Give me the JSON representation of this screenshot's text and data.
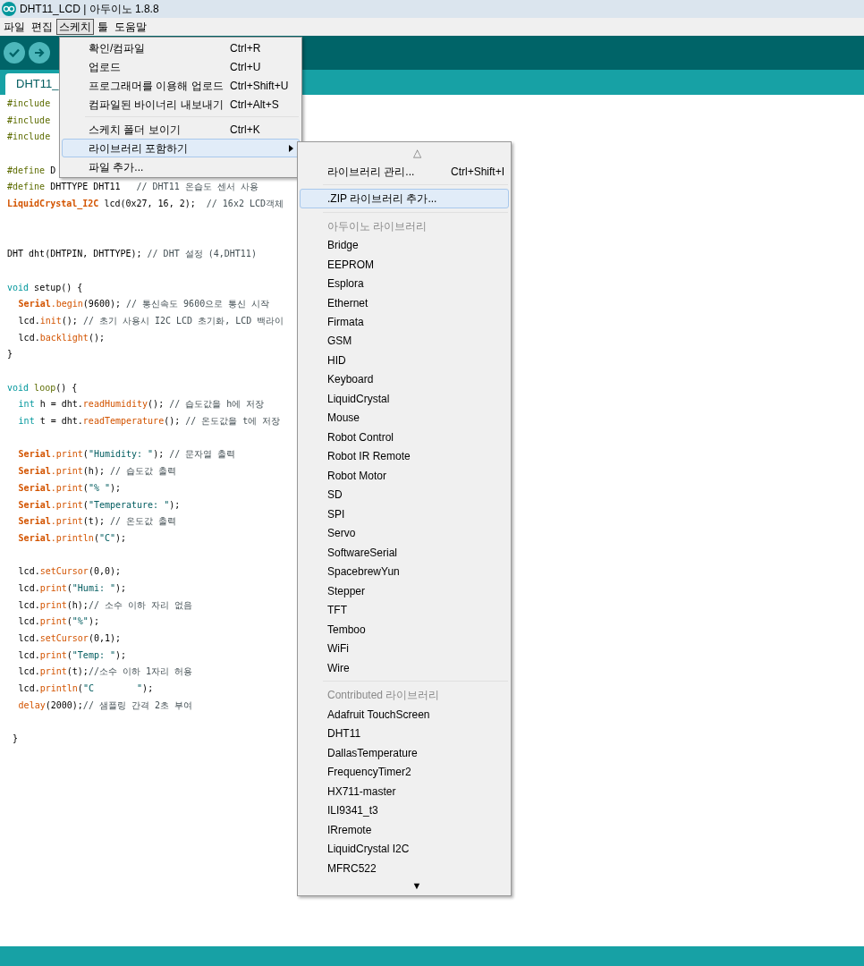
{
  "window": {
    "title": "DHT11_LCD | 아두이노 1.8.8"
  },
  "menu_bar": [
    {
      "label": "파일",
      "selected": false
    },
    {
      "label": "편집",
      "selected": false
    },
    {
      "label": "스케치",
      "selected": true
    },
    {
      "label": "툴",
      "selected": false
    },
    {
      "label": "도움말",
      "selected": false
    }
  ],
  "tab": {
    "label": "DHT11_"
  },
  "code_lines": [
    {
      "kind": "code",
      "indented": false,
      "segments": [
        {
          "kind": "pp",
          "text": "#include"
        }
      ]
    },
    {
      "kind": "code",
      "indented": false,
      "segments": [
        {
          "kind": "pp",
          "text": "#include"
        }
      ]
    },
    {
      "kind": "code",
      "indented": false,
      "segments": [
        {
          "kind": "pp",
          "text": "#include"
        }
      ]
    },
    {
      "kind": "blank"
    },
    {
      "kind": "code",
      "indented": false,
      "segments": [
        {
          "kind": "pp",
          "text": "#define"
        },
        {
          "kind": "p",
          "text": " D"
        }
      ]
    },
    {
      "kind": "code",
      "indented": false,
      "segments": [
        {
          "kind": "pp",
          "text": "#define"
        },
        {
          "kind": "p",
          "text": " DHTTYPE DHT11   "
        },
        {
          "kind": "cm",
          "text": "// DHT11 온습도 센서 사용"
        }
      ]
    },
    {
      "kind": "code",
      "indented": false,
      "segments": [
        {
          "kind": "cls",
          "text": "LiquidCrystal_I2C"
        },
        {
          "kind": "p",
          "text": " lcd(0x27, 16, 2);  "
        },
        {
          "kind": "cm",
          "text": "// 16x2 LCD객체"
        }
      ]
    },
    {
      "kind": "blank"
    },
    {
      "kind": "blank"
    },
    {
      "kind": "code",
      "indented": false,
      "segments": [
        {
          "kind": "p",
          "text": "DHT dht(DHTPIN, DHTTYPE); "
        },
        {
          "kind": "cm",
          "text": "// DHT 설정 (4,DHT11)"
        }
      ]
    },
    {
      "kind": "blank"
    },
    {
      "kind": "code",
      "indented": false,
      "segments": [
        {
          "kind": "kw",
          "text": "void"
        },
        {
          "kind": "p",
          "text": " setup() {"
        }
      ]
    },
    {
      "kind": "code",
      "indented": true,
      "segments": [
        {
          "kind": "cls",
          "text": "Serial"
        },
        {
          "kind": "fn",
          "text": ".begin"
        },
        {
          "kind": "p",
          "text": "(9600); "
        },
        {
          "kind": "cm",
          "text": "// 통신속도 9600으로 통신 시작"
        }
      ]
    },
    {
      "kind": "code",
      "indented": true,
      "segments": [
        {
          "kind": "p",
          "text": "lcd."
        },
        {
          "kind": "fn",
          "text": "init"
        },
        {
          "kind": "p",
          "text": "(); "
        },
        {
          "kind": "cm",
          "text": "// 초기 사용시 I2C LCD 초기화, LCD 백라이"
        }
      ]
    },
    {
      "kind": "code",
      "indented": true,
      "segments": [
        {
          "kind": "p",
          "text": "lcd."
        },
        {
          "kind": "fn",
          "text": "backlight"
        },
        {
          "kind": "p",
          "text": "();"
        }
      ]
    },
    {
      "kind": "code",
      "indented": false,
      "segments": [
        {
          "kind": "p",
          "text": "}"
        }
      ]
    },
    {
      "kind": "blank"
    },
    {
      "kind": "code",
      "indented": false,
      "segments": [
        {
          "kind": "kw",
          "text": "void"
        },
        {
          "kind": "kw2",
          "text": " loop"
        },
        {
          "kind": "p",
          "text": "() {"
        }
      ]
    },
    {
      "kind": "code",
      "indented": true,
      "segments": [
        {
          "kind": "kw",
          "text": "int"
        },
        {
          "kind": "p",
          "text": " h = dht."
        },
        {
          "kind": "fn",
          "text": "readHumidity"
        },
        {
          "kind": "p",
          "text": "(); "
        },
        {
          "kind": "cm",
          "text": "// 습도값을 h에 저장"
        }
      ]
    },
    {
      "kind": "code",
      "indented": true,
      "segments": [
        {
          "kind": "kw",
          "text": "int"
        },
        {
          "kind": "p",
          "text": " t = dht."
        },
        {
          "kind": "fn",
          "text": "readTemperature"
        },
        {
          "kind": "p",
          "text": "(); "
        },
        {
          "kind": "cm",
          "text": "// 온도값을 t에 저장"
        }
      ]
    },
    {
      "kind": "blank"
    },
    {
      "kind": "code",
      "indented": true,
      "segments": [
        {
          "kind": "cls",
          "text": "Serial"
        },
        {
          "kind": "fn",
          "text": ".print"
        },
        {
          "kind": "p",
          "text": "("
        },
        {
          "kind": "str",
          "text": "\"Humidity: \""
        },
        {
          "kind": "p",
          "text": "); "
        },
        {
          "kind": "cm",
          "text": "// 문자열 출력"
        }
      ]
    },
    {
      "kind": "code",
      "indented": true,
      "segments": [
        {
          "kind": "cls",
          "text": "Serial"
        },
        {
          "kind": "fn",
          "text": ".print"
        },
        {
          "kind": "p",
          "text": "(h); "
        },
        {
          "kind": "cm",
          "text": "// 습도값 출력"
        }
      ]
    },
    {
      "kind": "code",
      "indented": true,
      "segments": [
        {
          "kind": "cls",
          "text": "Serial"
        },
        {
          "kind": "fn",
          "text": ".print"
        },
        {
          "kind": "p",
          "text": "("
        },
        {
          "kind": "str",
          "text": "\"% \""
        },
        {
          "kind": "p",
          "text": ");"
        }
      ]
    },
    {
      "kind": "code",
      "indented": true,
      "segments": [
        {
          "kind": "cls",
          "text": "Serial"
        },
        {
          "kind": "fn",
          "text": ".print"
        },
        {
          "kind": "p",
          "text": "("
        },
        {
          "kind": "str",
          "text": "\"Temperature: \""
        },
        {
          "kind": "p",
          "text": ");"
        }
      ]
    },
    {
      "kind": "code",
      "indented": true,
      "segments": [
        {
          "kind": "cls",
          "text": "Serial"
        },
        {
          "kind": "fn",
          "text": ".print"
        },
        {
          "kind": "p",
          "text": "(t); "
        },
        {
          "kind": "cm",
          "text": "// 온도값 출력"
        }
      ]
    },
    {
      "kind": "code",
      "indented": true,
      "segments": [
        {
          "kind": "cls",
          "text": "Serial"
        },
        {
          "kind": "fn",
          "text": ".println"
        },
        {
          "kind": "p",
          "text": "("
        },
        {
          "kind": "str",
          "text": "\"C\""
        },
        {
          "kind": "p",
          "text": ");"
        }
      ]
    },
    {
      "kind": "blank"
    },
    {
      "kind": "code",
      "indented": true,
      "segments": [
        {
          "kind": "p",
          "text": "lcd."
        },
        {
          "kind": "fn",
          "text": "setCursor"
        },
        {
          "kind": "p",
          "text": "(0,0);"
        }
      ]
    },
    {
      "kind": "code",
      "indented": true,
      "segments": [
        {
          "kind": "p",
          "text": "lcd."
        },
        {
          "kind": "fn",
          "text": "print"
        },
        {
          "kind": "p",
          "text": "("
        },
        {
          "kind": "str",
          "text": "\"Humi: \""
        },
        {
          "kind": "p",
          "text": ");"
        }
      ]
    },
    {
      "kind": "code",
      "indented": true,
      "segments": [
        {
          "kind": "p",
          "text": "lcd."
        },
        {
          "kind": "fn",
          "text": "print"
        },
        {
          "kind": "p",
          "text": "(h);"
        },
        {
          "kind": "cm",
          "text": "// 소수 이하 자리 없음"
        }
      ]
    },
    {
      "kind": "code",
      "indented": true,
      "segments": [
        {
          "kind": "p",
          "text": "lcd."
        },
        {
          "kind": "fn",
          "text": "print"
        },
        {
          "kind": "p",
          "text": "("
        },
        {
          "kind": "str",
          "text": "\"%\""
        },
        {
          "kind": "p",
          "text": ");"
        }
      ]
    },
    {
      "kind": "code",
      "indented": true,
      "segments": [
        {
          "kind": "p",
          "text": "lcd."
        },
        {
          "kind": "fn",
          "text": "setCursor"
        },
        {
          "kind": "p",
          "text": "(0,1);"
        }
      ]
    },
    {
      "kind": "code",
      "indented": true,
      "segments": [
        {
          "kind": "p",
          "text": "lcd."
        },
        {
          "kind": "fn",
          "text": "print"
        },
        {
          "kind": "p",
          "text": "("
        },
        {
          "kind": "str",
          "text": "\"Temp: \""
        },
        {
          "kind": "p",
          "text": ");"
        }
      ]
    },
    {
      "kind": "code",
      "indented": true,
      "segments": [
        {
          "kind": "p",
          "text": "lcd."
        },
        {
          "kind": "fn",
          "text": "print"
        },
        {
          "kind": "p",
          "text": "(t);"
        },
        {
          "kind": "cm",
          "text": "//소수 이하 1자리 허용"
        }
      ]
    },
    {
      "kind": "code",
      "indented": true,
      "segments": [
        {
          "kind": "p",
          "text": "lcd."
        },
        {
          "kind": "fn",
          "text": "println"
        },
        {
          "kind": "p",
          "text": "("
        },
        {
          "kind": "str",
          "text": "\"C        \""
        },
        {
          "kind": "p",
          "text": ");"
        }
      ]
    },
    {
      "kind": "code",
      "indented": true,
      "segments": [
        {
          "kind": "fn",
          "text": "delay"
        },
        {
          "kind": "p",
          "text": "(2000);"
        },
        {
          "kind": "cm",
          "text": "// 샘플링 간격 2초 부여"
        }
      ]
    },
    {
      "kind": "blank"
    },
    {
      "kind": "code",
      "indented": false,
      "segments": [
        {
          "kind": "p",
          "text": " }"
        }
      ]
    }
  ],
  "sketch_menu": [
    {
      "kind": "item",
      "label": "확인/컴파일",
      "shortcut": "Ctrl+R",
      "selected": false
    },
    {
      "kind": "item",
      "label": "업로드",
      "shortcut": "Ctrl+U",
      "selected": false
    },
    {
      "kind": "item",
      "label": "프로그래머를 이용해 업로드",
      "shortcut": "Ctrl+Shift+U",
      "selected": false
    },
    {
      "kind": "item",
      "label": "컴파일된 바이너리 내보내기",
      "shortcut": "Ctrl+Alt+S",
      "selected": false
    },
    {
      "kind": "separator"
    },
    {
      "kind": "item",
      "label": "스케치 폴더 보이기",
      "shortcut": "Ctrl+K",
      "selected": false
    },
    {
      "kind": "submenu",
      "label": "라이브러리 포함하기",
      "selected": true
    },
    {
      "kind": "item",
      "label": "파일 추가...",
      "selected": false
    }
  ],
  "library_submenu": {
    "scroll_up": "△",
    "scroll_down": "▼",
    "items": [
      {
        "kind": "item",
        "label": "라이브러리 관리...",
        "shortcut": "Ctrl+Shift+I",
        "selected": false
      },
      {
        "kind": "separator"
      },
      {
        "kind": "item",
        "label": ".ZIP 라이브러리 추가...",
        "selected": true
      },
      {
        "kind": "separator"
      },
      {
        "kind": "header",
        "label": "아두이노 라이브러리"
      },
      {
        "kind": "item",
        "label": "Bridge",
        "selected": false
      },
      {
        "kind": "item",
        "label": "EEPROM",
        "selected": false
      },
      {
        "kind": "item",
        "label": "Esplora",
        "selected": false
      },
      {
        "kind": "item",
        "label": "Ethernet",
        "selected": false
      },
      {
        "kind": "item",
        "label": "Firmata",
        "selected": false
      },
      {
        "kind": "item",
        "label": "GSM",
        "selected": false
      },
      {
        "kind": "item",
        "label": "HID",
        "selected": false
      },
      {
        "kind": "item",
        "label": "Keyboard",
        "selected": false
      },
      {
        "kind": "item",
        "label": "LiquidCrystal",
        "selected": false
      },
      {
        "kind": "item",
        "label": "Mouse",
        "selected": false
      },
      {
        "kind": "item",
        "label": "Robot Control",
        "selected": false
      },
      {
        "kind": "item",
        "label": "Robot IR Remote",
        "selected": false
      },
      {
        "kind": "item",
        "label": "Robot Motor",
        "selected": false
      },
      {
        "kind": "item",
        "label": "SD",
        "selected": false
      },
      {
        "kind": "item",
        "label": "SPI",
        "selected": false
      },
      {
        "kind": "item",
        "label": "Servo",
        "selected": false
      },
      {
        "kind": "item",
        "label": "SoftwareSerial",
        "selected": false
      },
      {
        "kind": "item",
        "label": "SpacebrewYun",
        "selected": false
      },
      {
        "kind": "item",
        "label": "Stepper",
        "selected": false
      },
      {
        "kind": "item",
        "label": "TFT",
        "selected": false
      },
      {
        "kind": "item",
        "label": "Temboo",
        "selected": false
      },
      {
        "kind": "item",
        "label": "WiFi",
        "selected": false
      },
      {
        "kind": "item",
        "label": "Wire",
        "selected": false
      },
      {
        "kind": "separator"
      },
      {
        "kind": "header",
        "label": "Contributed 라이브러리"
      },
      {
        "kind": "item",
        "label": "Adafruit TouchScreen",
        "selected": false
      },
      {
        "kind": "item",
        "label": "DHT11",
        "selected": false
      },
      {
        "kind": "item",
        "label": "DallasTemperature",
        "selected": false
      },
      {
        "kind": "item",
        "label": "FrequencyTimer2",
        "selected": false
      },
      {
        "kind": "item",
        "label": "HX711-master",
        "selected": false
      },
      {
        "kind": "item",
        "label": "ILI9341_t3",
        "selected": false
      },
      {
        "kind": "item",
        "label": "IRremote",
        "selected": false
      },
      {
        "kind": "item",
        "label": "LiquidCrystal I2C",
        "selected": false
      },
      {
        "kind": "item",
        "label": "MFRC522",
        "selected": false
      }
    ]
  }
}
